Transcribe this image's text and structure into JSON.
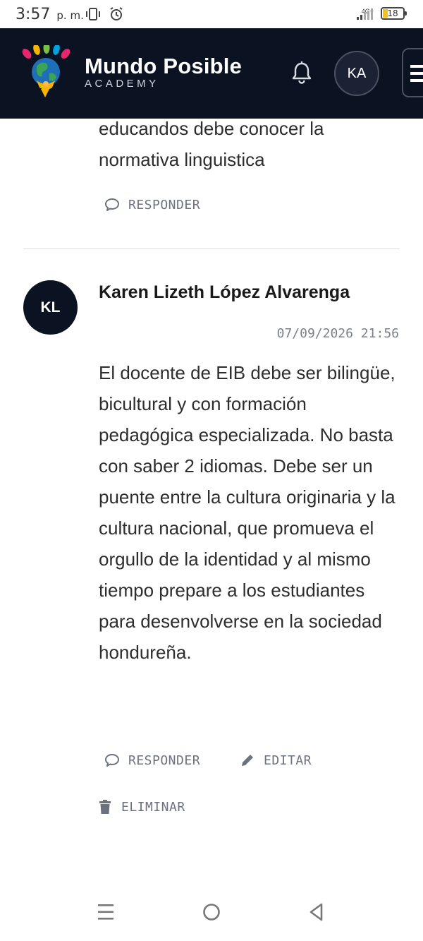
{
  "status_bar": {
    "time": "3:57",
    "ampm": "p. m.",
    "network": "4G+",
    "battery": "18"
  },
  "header": {
    "title": "Mundo Posible",
    "subtitle": "ACADEMY",
    "user_initials": "KA"
  },
  "previous_comment": {
    "text": "educandos debe conocer la normativa linguistica",
    "reply_label": "RESPONDER"
  },
  "comment": {
    "initials": "KL",
    "author": "Karen Lizeth López Alvarenga",
    "timestamp": "07/09/2026 21:56",
    "text": "El docente de EIB debe ser bilingüe, bicultural y con formación pedagógica especializada. No basta con saber 2 idiomas. Debe ser un puente entre la cultura originaria y la cultura nacional, que promueva el orgullo de la identidad y al mismo tiempo prepare a los estudiantes para desenvolverse en la sociedad hondureña.",
    "reply_label": "RESPONDER",
    "edit_label": "EDITAR",
    "delete_label": "ELIMINAR"
  },
  "colors": {
    "header_bg": "#0b1222",
    "action_gray": "#6d7280",
    "divider": "#dcdcdc"
  }
}
